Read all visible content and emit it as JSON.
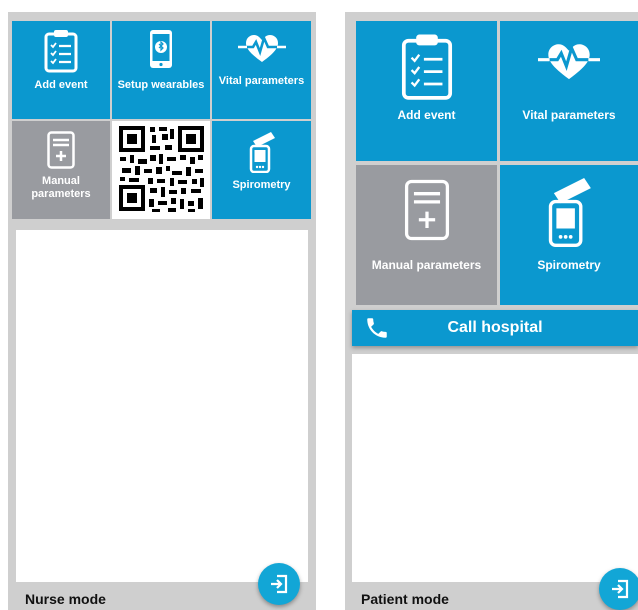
{
  "nurse_screen": {
    "tiles": {
      "add_event": "Add event",
      "setup_wearables": "Setup wearables",
      "vital_parameters": "Vital parameters",
      "manual_parameters": "Manual parameters",
      "spirometry": "Spirometry"
    },
    "mode_label": "Nurse mode"
  },
  "patient_screen": {
    "tiles": {
      "add_event": "Add event",
      "vital_parameters": "Vital parameters",
      "manual_parameters": "Manual parameters",
      "spirometry": "Spirometry"
    },
    "call_button": "Call hospital",
    "mode_label": "Patient mode"
  },
  "icons": {
    "add_event": "clipboard-checklist-icon",
    "setup_wearables": "phone-bluetooth-icon",
    "vital_parameters": "heart-pulse-icon",
    "manual_parameters": "form-plus-icon",
    "spirometry": "spirometer-icon",
    "qr": "qr-code",
    "call": "phone-handset-icon",
    "fab": "logout-door-icon"
  },
  "colors": {
    "tile_blue": "#0b98cf",
    "tile_gray": "#999ba0",
    "frame": "#cfcfcf",
    "fab": "#12a6d6"
  }
}
